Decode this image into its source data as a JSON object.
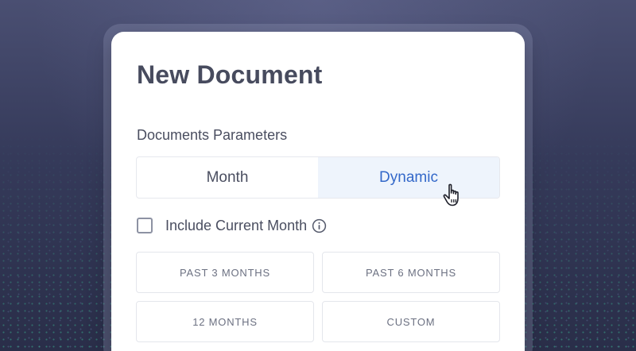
{
  "card": {
    "title": "New Document",
    "section_label": "Documents Parameters"
  },
  "mode_toggle": {
    "options": [
      {
        "label": "Month",
        "active": false
      },
      {
        "label": "Dynamic",
        "active": true
      }
    ],
    "active_color": "#3368c9"
  },
  "include_current_month": {
    "label": "Include Current Month",
    "checked": false,
    "icon": "info-icon"
  },
  "range_options": [
    {
      "label": "PAST 3 MONTHS"
    },
    {
      "label": "PAST 6 MONTHS"
    },
    {
      "label": "12 MONTHS"
    },
    {
      "label": "CUSTOM"
    }
  ],
  "cursor_icon": "hand-pointer-icon"
}
